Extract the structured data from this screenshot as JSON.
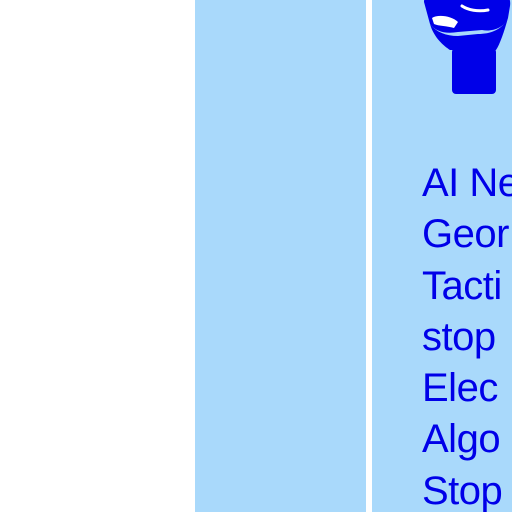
{
  "colors": {
    "panel_background": "#a9d9fb",
    "text_color": "#0000e8",
    "icon_color": "#0000e8"
  },
  "card": {
    "icon": "raised-fist-icon",
    "lines": [
      "AI Ne",
      "Geor",
      "Tacti",
      "stop",
      "Elec",
      "Algo",
      "Stop"
    ]
  }
}
